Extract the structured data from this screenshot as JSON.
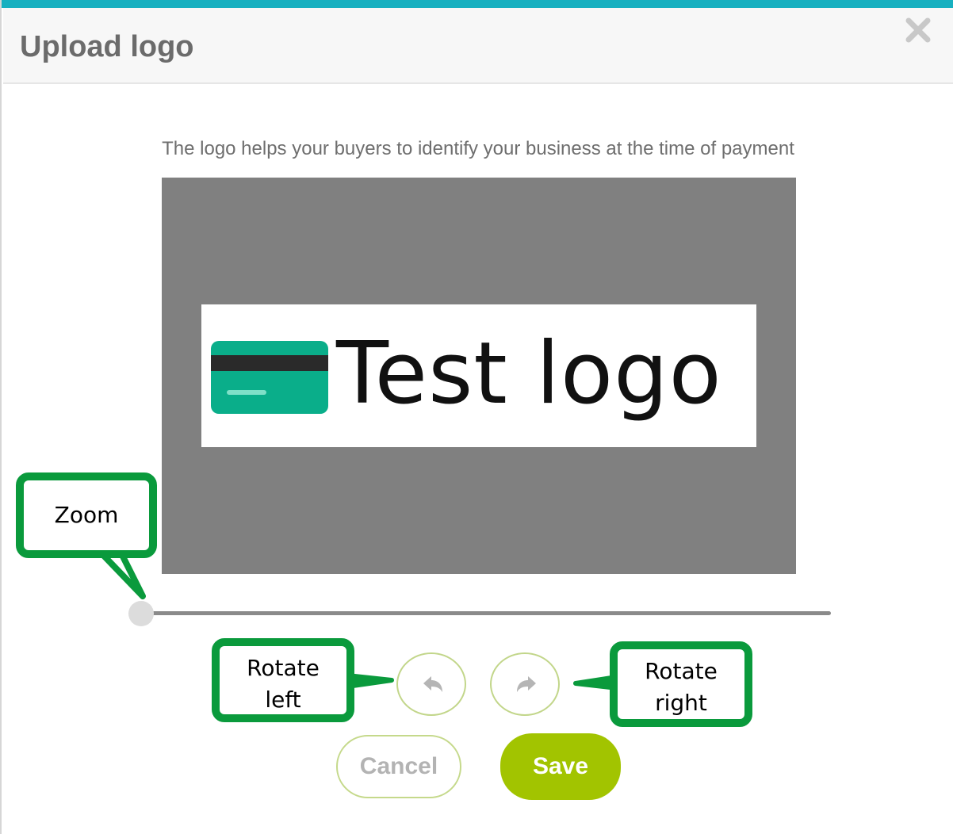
{
  "dialog": {
    "title": "Upload logo",
    "close_icon": "close-icon",
    "description": "The logo helps your buyers to identify your business at the time of payment",
    "accent_color": "#17b0c0"
  },
  "preview": {
    "logo_text": "Test logo",
    "logo_icon": "credit-card-icon",
    "card_color": "#0aae8a",
    "background_color": "#808080"
  },
  "zoom": {
    "value": 0
  },
  "rotate": {
    "left_icon": "rotate-left-icon",
    "right_icon": "rotate-right-icon"
  },
  "buttons": {
    "cancel_label": "Cancel",
    "save_label": "Save",
    "save_color": "#a2c400"
  },
  "annotations": {
    "zoom_label": "Zoom",
    "rotate_left_line1": "Rotate",
    "rotate_left_line2": "left",
    "rotate_right_line1": "Rotate",
    "rotate_right_line2": "right",
    "color": "#0a9a3c"
  }
}
